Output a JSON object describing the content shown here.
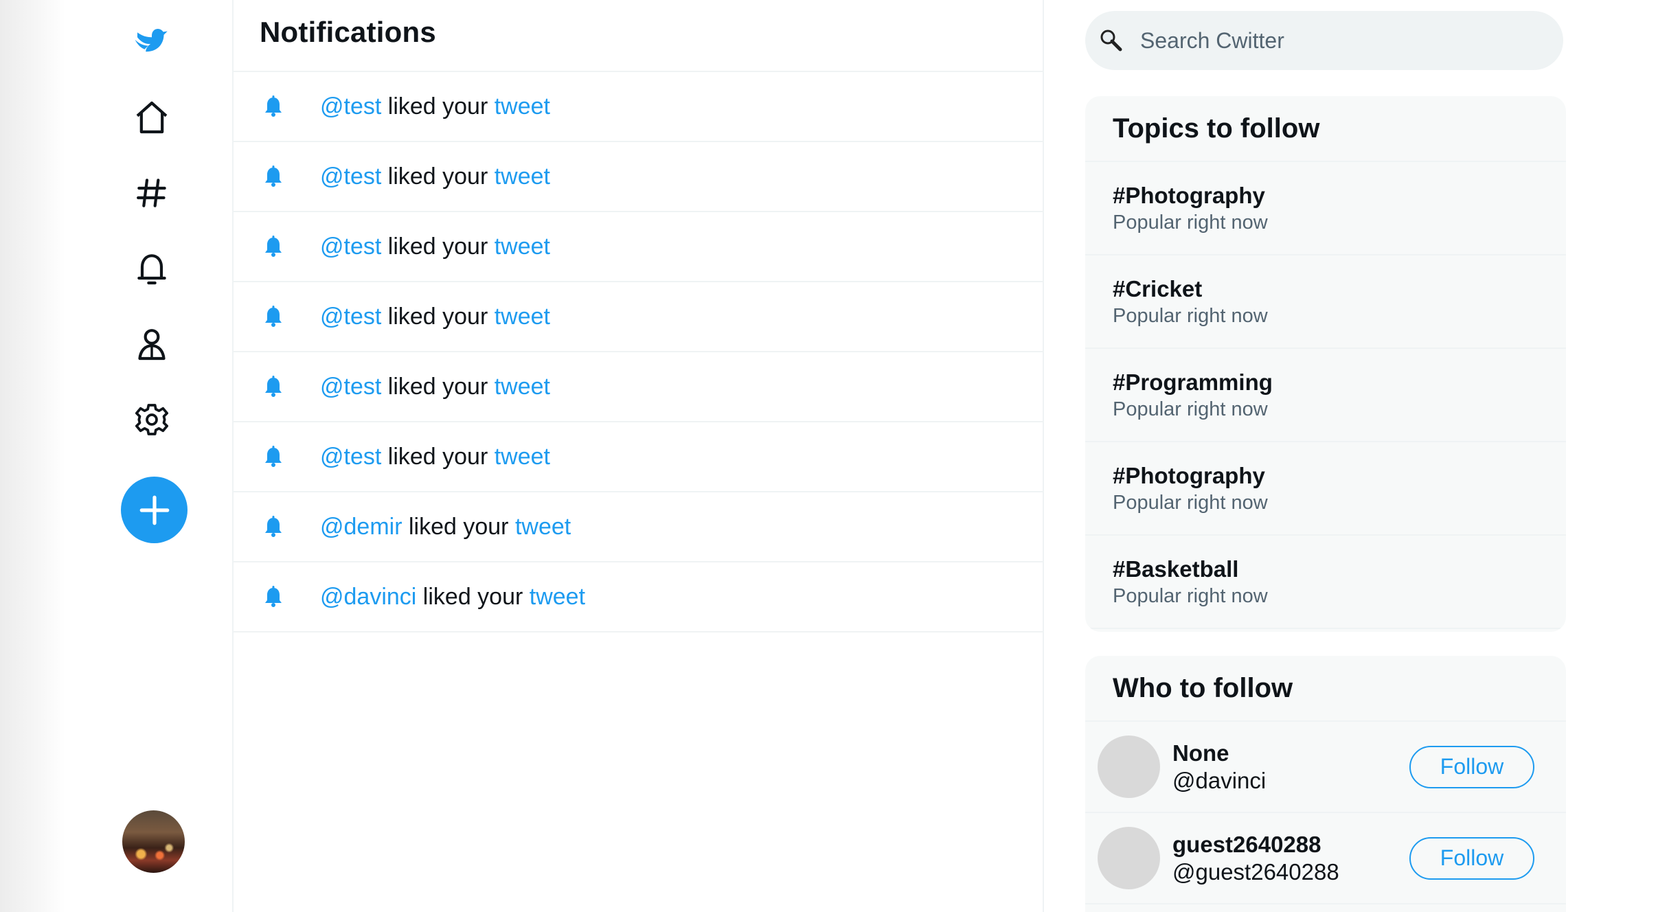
{
  "colors": {
    "accent": "#1d9bf0",
    "muted": "#536471",
    "border": "#eff3f4",
    "panel_bg": "#f7f9f9"
  },
  "sidebar": {
    "items": [
      {
        "icon": "bird-logo-icon"
      },
      {
        "icon": "home-icon"
      },
      {
        "icon": "hashtag-icon"
      },
      {
        "icon": "bell-icon"
      },
      {
        "icon": "profile-icon"
      },
      {
        "icon": "gear-icon"
      },
      {
        "icon": "plus-icon"
      }
    ]
  },
  "main": {
    "title": "Notifications",
    "notifications": [
      {
        "user": "@test",
        "action": " liked your ",
        "object": "tweet"
      },
      {
        "user": "@test",
        "action": " liked your ",
        "object": "tweet"
      },
      {
        "user": "@test",
        "action": " liked your ",
        "object": "tweet"
      },
      {
        "user": "@test",
        "action": " liked your ",
        "object": "tweet"
      },
      {
        "user": "@test",
        "action": " liked your ",
        "object": "tweet"
      },
      {
        "user": "@test",
        "action": " liked your ",
        "object": "tweet"
      },
      {
        "user": "@demir",
        "action": " liked your ",
        "object": "tweet"
      },
      {
        "user": "@davinci",
        "action": " liked your ",
        "object": "tweet"
      }
    ]
  },
  "search": {
    "placeholder": "Search Cwitter"
  },
  "topics": {
    "title": "Topics to follow",
    "items": [
      {
        "name": "#Photography",
        "sub": "Popular right now"
      },
      {
        "name": "#Cricket",
        "sub": "Popular right now"
      },
      {
        "name": "#Programming",
        "sub": "Popular right now"
      },
      {
        "name": "#Photography",
        "sub": "Popular right now"
      },
      {
        "name": "#Basketball",
        "sub": "Popular right now"
      }
    ]
  },
  "who": {
    "title": "Who to follow",
    "items": [
      {
        "name": "None",
        "handle": "@davinci",
        "button": "Follow"
      },
      {
        "name": "guest2640288",
        "handle": "@guest2640288",
        "button": "Follow"
      }
    ]
  }
}
